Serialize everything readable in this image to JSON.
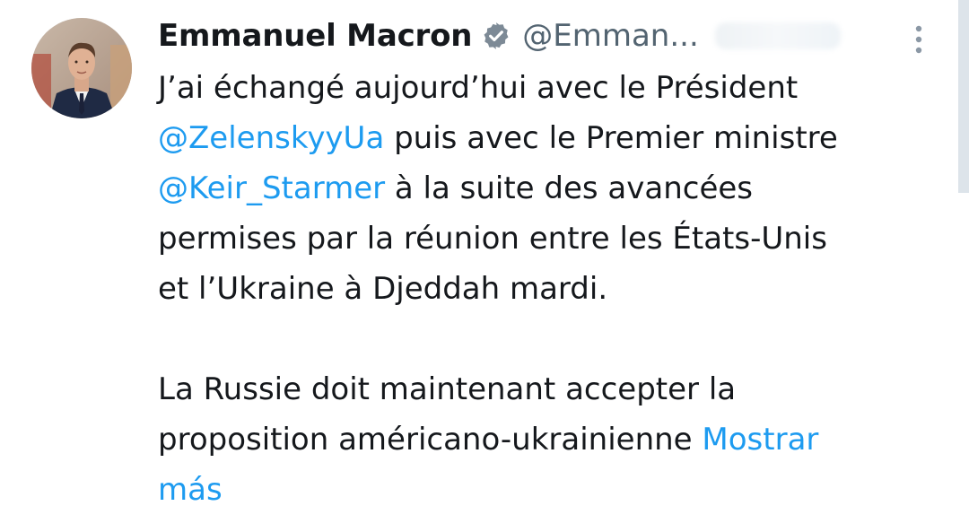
{
  "tweet": {
    "author": {
      "display_name": "Emmanuel Macron",
      "handle": "@Emman...",
      "verified_icon": "verified-badge-icon"
    },
    "menu_icon": "more-vertical-icon",
    "text": {
      "p1": {
        "l1": "J’ai échangé aujourd’hui avec le Président",
        "l2_mention": "@ZelenskyyUa",
        "l2_rest": " puis avec le Premier ministre",
        "l3_mention": "@Keir_Starmer",
        "l3_rest": " à la suite des avancées",
        "l4": "permises par la réunion entre les États-Unis",
        "l5": "et l’Ukraine à Djeddah mardi."
      },
      "p2": {
        "l1": "La Russie doit maintenant accepter la",
        "l2": "proposition américano-ukrainienne ",
        "l2_link": "Mostrar",
        "l3_link": "más"
      }
    },
    "colors": {
      "text": "#15181c",
      "secondary": "#536471",
      "link": "#1d9bf0"
    }
  }
}
